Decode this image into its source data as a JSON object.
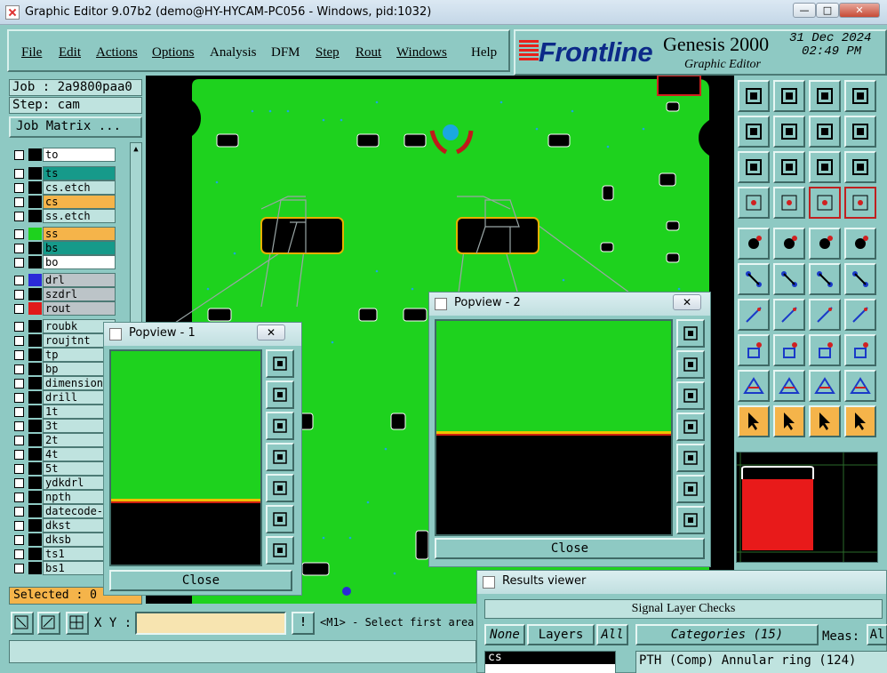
{
  "window": {
    "title": "Graphic Editor 9.07b2 (demo@HY-HYCAM-PC056 - Windows, pid:1032)",
    "min_label": "—",
    "max_label": "□",
    "close_label": "✕"
  },
  "menu": {
    "items": [
      "File",
      "Edit",
      "Actions",
      "Options",
      "Analysis",
      "DFM",
      "Step",
      "Rout",
      "Windows",
      "Help"
    ]
  },
  "brand": {
    "logo": "Frontline",
    "product": "Genesis 2000",
    "subtitle": "Graphic Editor",
    "date": "31 Dec 2024",
    "time": "02:49 PM"
  },
  "job": {
    "job_label": "Job : 2a9800paa0",
    "step_label": "Step: cam",
    "matrix_button": "Job Matrix ..."
  },
  "layers": [
    {
      "name": "to",
      "bg": "#ffffff",
      "swatch": "#000000"
    },
    {
      "name": "ts",
      "bg": "#169a8a",
      "swatch": "#000000"
    },
    {
      "name": "cs.etch",
      "bg": "#bfe3df",
      "swatch": "#000000"
    },
    {
      "name": "cs",
      "bg": "#f5b44a",
      "swatch": "#000000"
    },
    {
      "name": "ss.etch",
      "bg": "#bfe3df",
      "swatch": "#000000"
    },
    {
      "name": "ss",
      "bg": "#f5b44a",
      "swatch": "#1ed21e"
    },
    {
      "name": "bs",
      "bg": "#169a8a",
      "swatch": "#000000"
    },
    {
      "name": "bo",
      "bg": "#ffffff",
      "swatch": "#000000"
    },
    {
      "name": "drl",
      "bg": "#bcc4c8",
      "swatch": "#2a2ad8"
    },
    {
      "name": "szdrl",
      "bg": "#bcc4c8",
      "swatch": "#000000"
    },
    {
      "name": "rout",
      "bg": "#bcc4c8",
      "swatch": "#e01a1a"
    },
    {
      "name": "roubk",
      "bg": "#bfe3df",
      "swatch": "#000000"
    },
    {
      "name": "roujtnt",
      "bg": "#bfe3df",
      "swatch": "#000000"
    },
    {
      "name": "tp",
      "bg": "#bfe3df",
      "swatch": "#000000"
    },
    {
      "name": "bp",
      "bg": "#bfe3df",
      "swatch": "#000000"
    },
    {
      "name": "dimension",
      "bg": "#bfe3df",
      "swatch": "#000000"
    },
    {
      "name": "drill",
      "bg": "#bfe3df",
      "swatch": "#000000"
    },
    {
      "name": "1t",
      "bg": "#bfe3df",
      "swatch": "#000000"
    },
    {
      "name": "3t",
      "bg": "#bfe3df",
      "swatch": "#000000"
    },
    {
      "name": "2t",
      "bg": "#bfe3df",
      "swatch": "#000000"
    },
    {
      "name": "4t",
      "bg": "#bfe3df",
      "swatch": "#000000"
    },
    {
      "name": "5t",
      "bg": "#bfe3df",
      "swatch": "#000000"
    },
    {
      "name": "ydkdrl",
      "bg": "#bfe3df",
      "swatch": "#000000"
    },
    {
      "name": "npth",
      "bg": "#bfe3df",
      "swatch": "#000000"
    },
    {
      "name": "datecode-",
      "bg": "#bfe3df",
      "swatch": "#000000"
    },
    {
      "name": "dkst",
      "bg": "#bfe3df",
      "swatch": "#000000"
    },
    {
      "name": "dksb",
      "bg": "#bfe3df",
      "swatch": "#000000"
    },
    {
      "name": "ts1",
      "bg": "#bfe3df",
      "swatch": "#000000"
    },
    {
      "name": "bs1",
      "bg": "#bfe3df",
      "swatch": "#000000"
    }
  ],
  "selected": "Selected : 0",
  "command": {
    "xy_label": "X Y :",
    "xy_value": "",
    "prompt": "<M1> - Select first area"
  },
  "popview1": {
    "title": "Popview - 1",
    "close": "Close",
    "x": "✕"
  },
  "popview2": {
    "title": "Popview - 2",
    "close": "Close",
    "x": "✕"
  },
  "results": {
    "title": "Results viewer",
    "header": "Signal Layer Checks",
    "none": "None",
    "layers": "Layers",
    "all": "All",
    "categories": "Categories (15)",
    "meas": "Meas:",
    "meas_val": "Al",
    "layer_item": "cs",
    "category_item": "PTH (Comp) Annular ring (124)"
  },
  "colors": {
    "board_green": "#1ed21e",
    "panel": "#8ec9c3",
    "highlight": "#f5b44a"
  }
}
